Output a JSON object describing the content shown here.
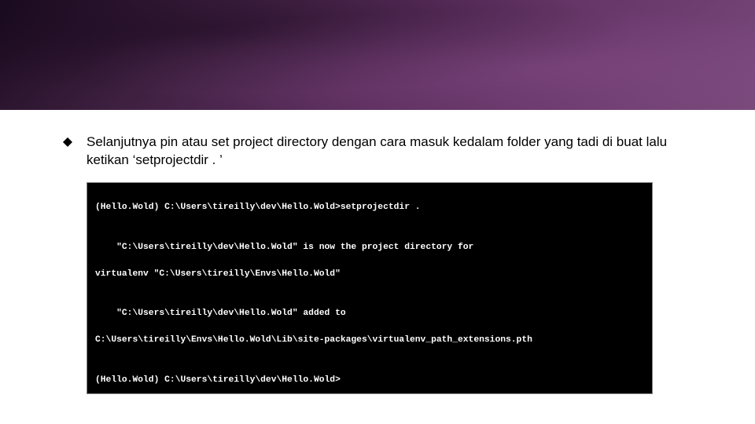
{
  "bullet": {
    "text": "Selanjutnya pin atau set project directory dengan cara masuk kedalam folder yang tadi di buat lalu ketikan ‘setprojectdir . ’"
  },
  "terminal": {
    "l1": "(Hello.Wold) C:\\Users\\tireilly\\dev\\Hello.Wold>setprojectdir .",
    "l2": "",
    "l3": "    \"C:\\Users\\tireilly\\dev\\Hello.Wold\" is now the project directory for",
    "l4": "virtualenv \"C:\\Users\\tireilly\\Envs\\Hello.Wold\"",
    "l5": "",
    "l6": "    \"C:\\Users\\tireilly\\dev\\Hello.Wold\" added to",
    "l7": "C:\\Users\\tireilly\\Envs\\Hello.Wold\\Lib\\site-packages\\virtualenv_path_extensions.pth",
    "l8": "",
    "l9": "(Hello.Wold) C:\\Users\\tireilly\\dev\\Hello.Wold>"
  }
}
